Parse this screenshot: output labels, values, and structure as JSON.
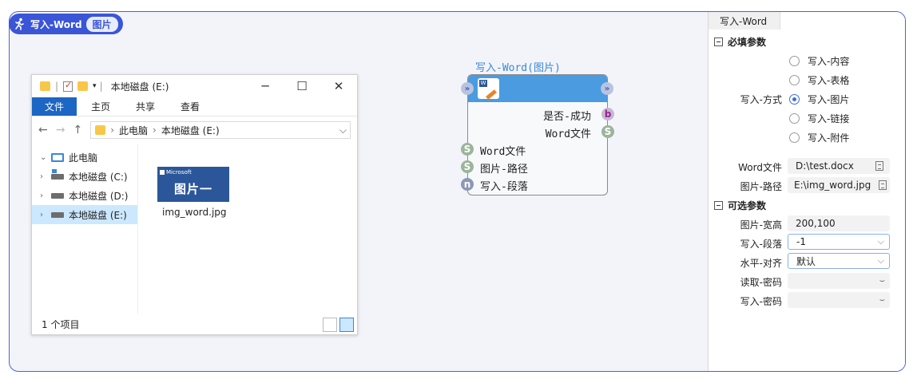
{
  "canvas": {
    "title": "写入-Word",
    "badge": "图片"
  },
  "explorer": {
    "window_title": "本地磁盘 (E:)",
    "ribbon": {
      "file_tab": "文件",
      "tabs": [
        "主页",
        "共享",
        "查看"
      ]
    },
    "address": {
      "parts": [
        "此电脑",
        "本地磁盘 (E:)"
      ]
    },
    "tree": [
      {
        "label": "此电脑",
        "expanded": true,
        "selected": false
      },
      {
        "label": "本地磁盘 (C:)",
        "expanded": false,
        "selected": false
      },
      {
        "label": "本地磁盘 (D:)",
        "expanded": false,
        "selected": false
      },
      {
        "label": "本地磁盘 (E:)",
        "expanded": false,
        "selected": true
      }
    ],
    "file": {
      "thumb_brand": "Microsoft",
      "thumb_text": "图片一",
      "name": "img_word.jpg"
    },
    "status": "1 个项目"
  },
  "node": {
    "title": "写入-Word(图片)",
    "outputs": [
      {
        "label": "是否-成功",
        "type": "b"
      },
      {
        "label": "Word文件",
        "type": "S"
      }
    ],
    "inputs": [
      {
        "label": "Word文件",
        "type": "S"
      },
      {
        "label": "图片-路径",
        "type": "S"
      },
      {
        "label": "写入-段落",
        "type": "n"
      }
    ]
  },
  "panel": {
    "tab": "写入-Word",
    "required_section": "必填参数",
    "write_mode_label": "写入-方式",
    "write_modes": [
      {
        "label": "写入-内容",
        "selected": false
      },
      {
        "label": "写入-表格",
        "selected": false
      },
      {
        "label": "写入-图片",
        "selected": true
      },
      {
        "label": "写入-链接",
        "selected": false
      },
      {
        "label": "写入-附件",
        "selected": false
      }
    ],
    "word_file_label": "Word文件",
    "word_file_value": "D:\\test.docx",
    "image_path_label": "图片-路径",
    "image_path_value": "E:\\img_word.jpg",
    "optional_section": "可选参数",
    "image_size_label": "图片-宽高",
    "image_size_value": "200,100",
    "paragraph_label": "写入-段落",
    "paragraph_value": "-1",
    "align_label": "水平-对齐",
    "align_value": "默认",
    "read_pwd_label": "读取-密码",
    "read_pwd_value": "",
    "write_pwd_label": "写入-密码",
    "write_pwd_value": ""
  }
}
